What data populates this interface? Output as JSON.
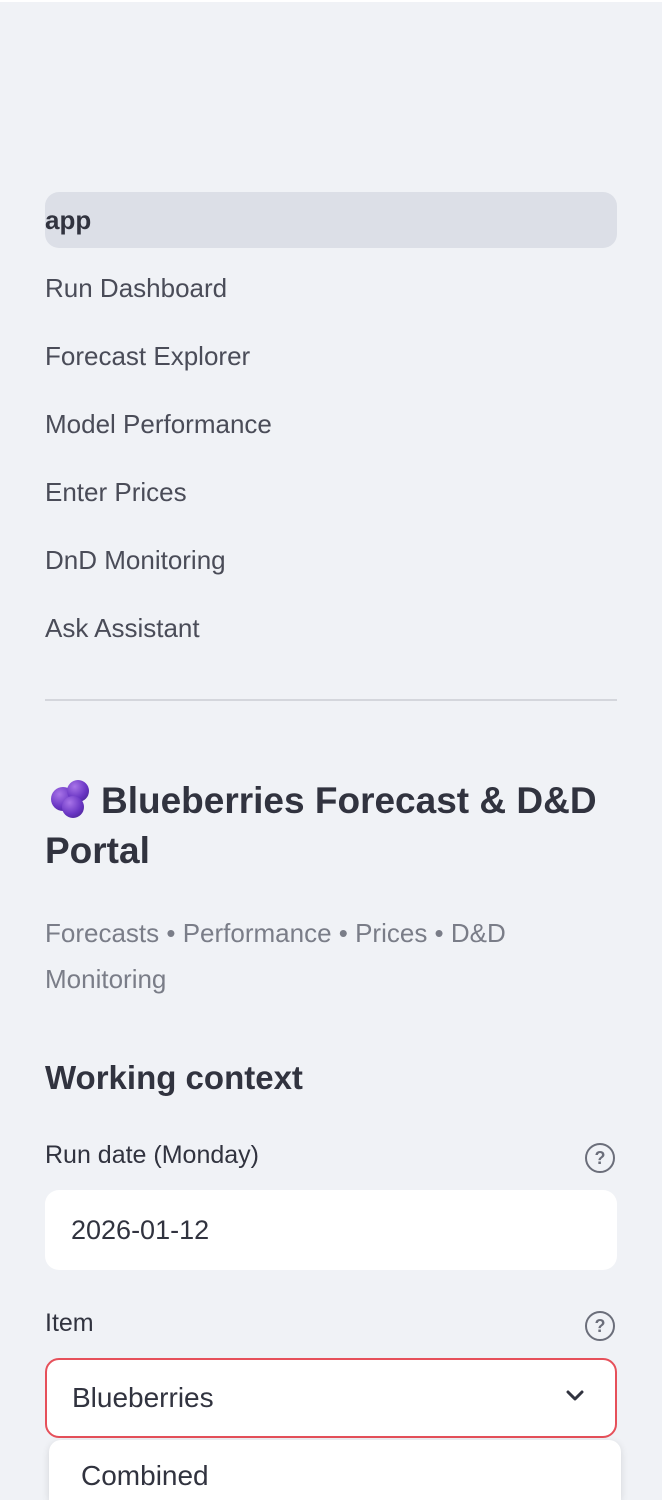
{
  "nav": {
    "items": [
      {
        "label": "app",
        "active": true
      },
      {
        "label": "Run Dashboard"
      },
      {
        "label": "Forecast Explorer"
      },
      {
        "label": "Model Performance"
      },
      {
        "label": "Enter Prices"
      },
      {
        "label": "DnD Monitoring"
      },
      {
        "label": "Ask Assistant"
      }
    ]
  },
  "brand": {
    "icon": "blueberries-icon",
    "title": "Blueberries Forecast & D&D Portal",
    "subtitle": "Forecasts • Performance • Prices • D&D Monitoring"
  },
  "context": {
    "heading": "Working context",
    "run_date": {
      "label": "Run date (Monday)",
      "value": "2026-01-12",
      "help_icon": "help-circle-icon"
    },
    "item": {
      "label": "Item",
      "selected": "Blueberries",
      "help_icon": "help-circle-icon",
      "options_visible": [
        "Combined"
      ]
    }
  },
  "colors": {
    "sidebar_bg": "#f0f2f6",
    "active_nav_bg": "#dcdfe7",
    "focus_border": "#e6505a",
    "text": "#31333f",
    "muted_text": "#7a7d88"
  }
}
